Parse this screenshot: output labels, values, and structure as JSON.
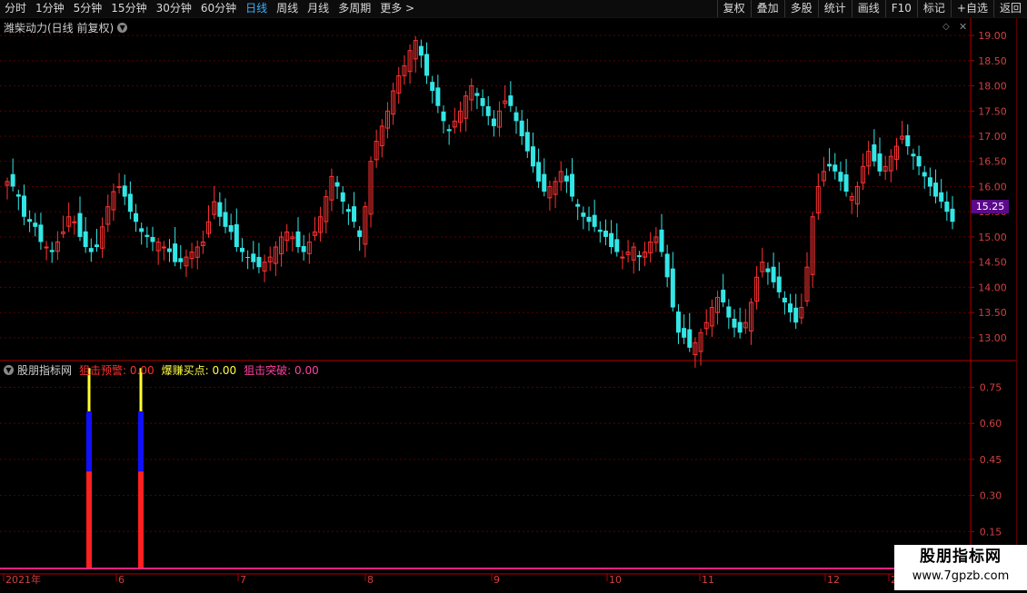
{
  "toolbar": {
    "periods": [
      "分时",
      "1分钟",
      "5分钟",
      "15分钟",
      "30分钟",
      "60分钟",
      "日线",
      "周线",
      "月线",
      "多周期",
      "更多 >"
    ],
    "active_period": "日线",
    "tools": [
      "复权",
      "叠加",
      "多股",
      "统计",
      "画线",
      "F10",
      "标记",
      "+自选",
      "返回"
    ]
  },
  "price_panel": {
    "title": "潍柴动力(日线 前复权)",
    "current_price": "15.25",
    "y_ticks": [
      "19.00",
      "18.50",
      "18.00",
      "17.50",
      "17.00",
      "16.50",
      "16.00",
      "15.50",
      "15.00",
      "14.50",
      "14.00",
      "13.50",
      "13.00"
    ]
  },
  "indicator_panel": {
    "name": "股朋指标网",
    "items": [
      {
        "label": "狙击预警: 0.00",
        "color": "#ff3030"
      },
      {
        "label": "爆赚买点: 0.00",
        "color": "#ffff40"
      },
      {
        "label": "狙击突破: 0.00",
        "color": "#ff40a0"
      }
    ],
    "y_ticks": [
      "0.75",
      "0.60",
      "0.45",
      "0.30",
      "0.15"
    ]
  },
  "x_axis": {
    "labels": [
      "2021年",
      "6",
      "7",
      "8",
      "9",
      "10",
      "11",
      "12",
      "2"
    ]
  },
  "watermark": {
    "title": "股朋指标网",
    "url": "www.7gpzb.com"
  },
  "colors": {
    "up": "#ff3232",
    "down": "#33e6e6",
    "grid": "#5a0000",
    "axis": "#b00000",
    "bar_red": "#ff2020",
    "bar_blue": "#1010ff",
    "bar_yellow": "#ffff30"
  },
  "chart_data": {
    "type": "candlestick",
    "series_note": "approximate daily closes (前复权)",
    "closes": [
      16.1,
      16.0,
      15.8,
      15.4,
      15.3,
      15.2,
      14.9,
      14.8,
      14.7,
      14.9,
      15.1,
      15.4,
      15.3,
      15.0,
      14.8,
      14.7,
      14.8,
      15.2,
      15.6,
      15.9,
      16.0,
      15.8,
      15.5,
      15.3,
      15.1,
      15.0,
      14.9,
      14.9,
      14.8,
      14.7,
      14.5,
      14.5,
      14.6,
      14.7,
      14.8,
      14.9,
      15.3,
      15.7,
      15.4,
      15.2,
      15.1,
      14.8,
      14.7,
      14.6,
      14.5,
      14.4,
      14.5,
      14.6,
      14.8,
      15.0,
      15.1,
      15.0,
      14.8,
      14.7,
      14.9,
      15.1,
      15.4,
      15.8,
      16.2,
      16.0,
      15.7,
      15.5,
      15.3,
      15.0,
      15.6,
      16.5,
      16.9,
      17.2,
      17.5,
      17.9,
      18.2,
      18.4,
      18.7,
      18.9,
      18.6,
      18.2,
      17.9,
      17.6,
      17.3,
      17.1,
      17.3,
      17.5,
      17.8,
      18.0,
      17.8,
      17.6,
      17.4,
      17.2,
      17.5,
      17.7,
      17.6,
      17.3,
      17.0,
      16.7,
      16.4,
      16.1,
      15.9,
      16.0,
      16.1,
      16.3,
      16.1,
      15.8,
      15.6,
      15.4,
      15.3,
      15.2,
      15.1,
      15.0,
      14.8,
      14.7,
      14.6,
      14.7,
      14.8,
      14.6,
      14.7,
      14.9,
      15.0,
      14.7,
      14.2,
      13.6,
      13.1,
      13.0,
      12.8,
      12.9,
      13.1,
      13.3,
      13.6,
      13.8,
      13.7,
      13.4,
      13.2,
      13.1,
      13.3,
      13.7,
      14.2,
      14.5,
      14.3,
      14.1,
      13.9,
      13.7,
      13.5,
      13.3,
      13.6,
      14.4,
      15.4,
      16.0,
      16.3,
      16.4,
      16.3,
      16.1,
      15.9,
      15.8,
      16.0,
      16.4,
      16.7,
      16.5,
      16.3,
      16.4,
      16.6,
      16.8,
      17.0,
      16.8,
      16.6,
      16.4,
      16.2,
      16.0,
      15.8,
      15.7,
      15.5,
      15.3
    ],
    "signals_x": [
      98,
      155
    ],
    "y_range_price": [
      12.6,
      19.2
    ],
    "y_range_indicator": [
      0,
      0.85
    ]
  }
}
